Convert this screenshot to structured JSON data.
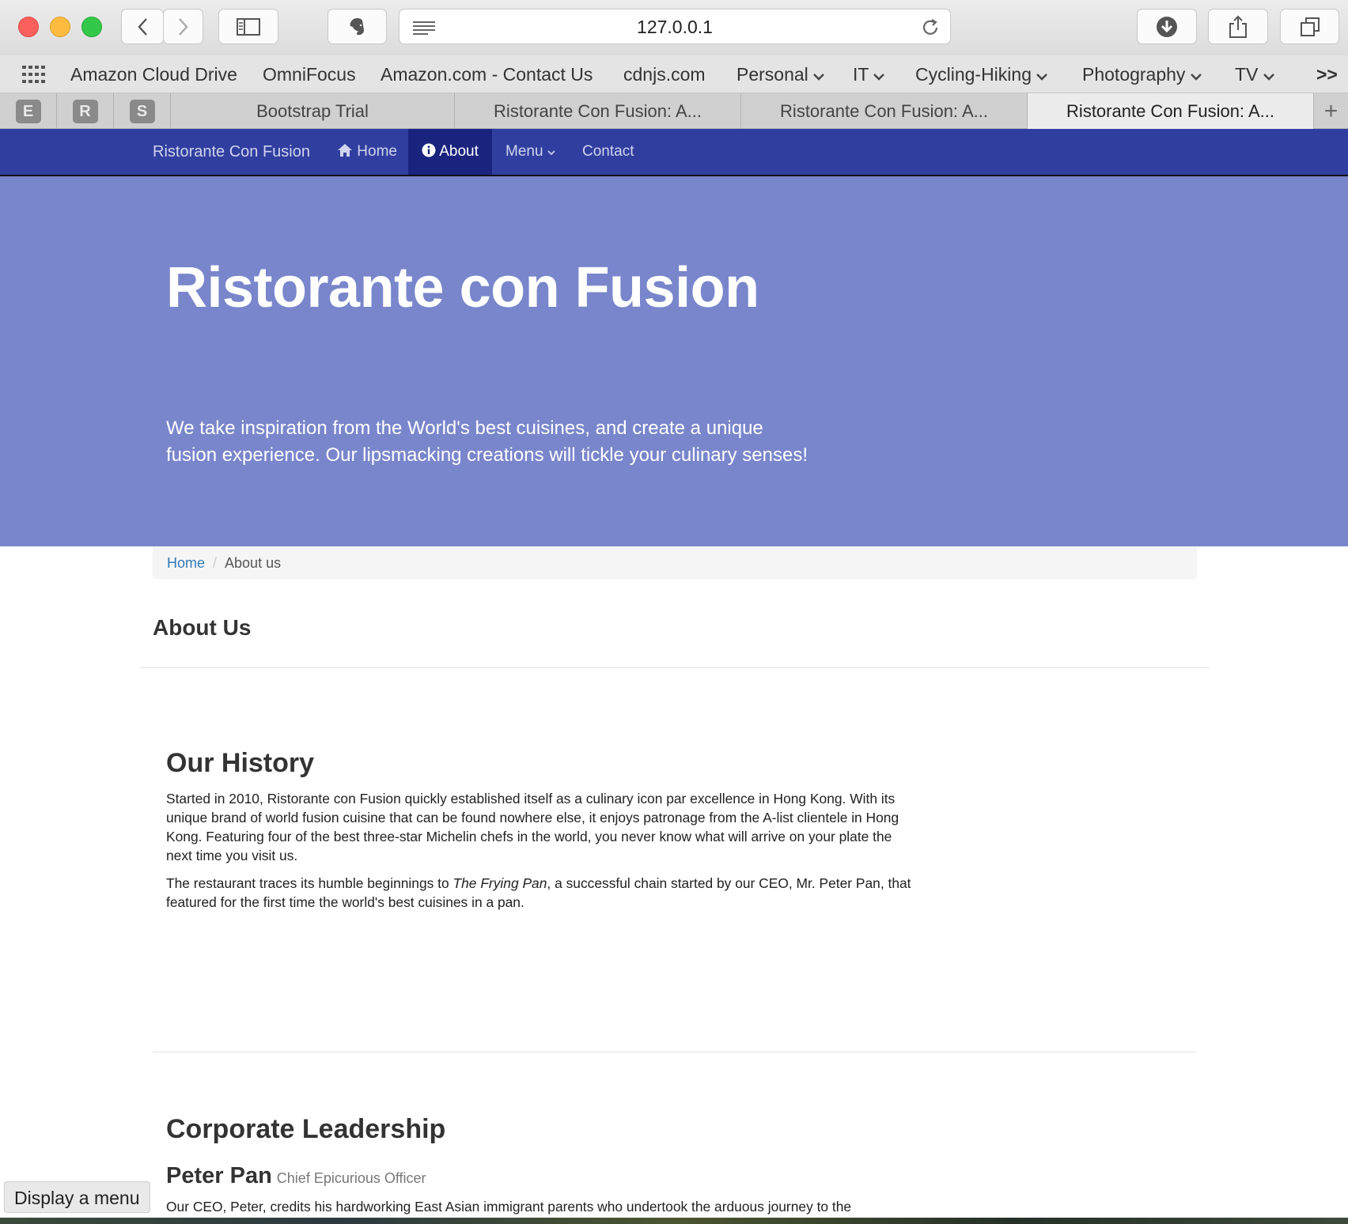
{
  "browser": {
    "url": "127.0.0.1",
    "bookmarks": [
      "Amazon Cloud Drive",
      "OmniFocus",
      "Amazon.com - Contact Us",
      "cdnjs.com",
      "Personal",
      "IT",
      "Cycling-Hiking",
      "Photography",
      "TV"
    ],
    "overflow": ">>",
    "pinned_tabs": [
      "E",
      "R",
      "S"
    ],
    "tabs": [
      "Bootstrap Trial",
      "Ristorante Con Fusion: A...",
      "Ristorante Con Fusion: A...",
      "Ristorante Con Fusion: A..."
    ],
    "new_tab": "+",
    "status_tooltip": "Display a menu"
  },
  "navbar": {
    "brand": "Ristorante Con Fusion",
    "items": [
      {
        "label": "Home",
        "icon": "home-icon"
      },
      {
        "label": "About",
        "icon": "info-circle-icon",
        "active": true
      },
      {
        "label": "Menu",
        "icon": "caret-down-icon"
      },
      {
        "label": "Contact"
      }
    ],
    "colors": {
      "bar": "#303f9f",
      "active": "#1a237e"
    }
  },
  "jumbotron": {
    "title": "Ristorante con Fusion",
    "text": "We take inspiration from the World's best cuisines, and create a unique fusion experience. Our lipsmacking creations will tickle your culinary senses!",
    "color": "#7986cb"
  },
  "breadcrumb": {
    "home": "Home",
    "separator": "/",
    "current": "About us"
  },
  "page": {
    "heading": "About Us",
    "history": {
      "title": "Our History",
      "p1": "Started in 2010, Ristorante con Fusion quickly established itself as a culinary icon par excellence in Hong Kong. With its unique brand of world fusion cuisine that can be found nowhere else, it enjoys patronage from the A-list clientele in Hong Kong. Featuring four of the best three-star Michelin chefs in the world, you never know what will arrive on your plate the next time you visit us.",
      "p2_before": "The restaurant traces its humble beginnings to ",
      "p2_italic": "The Frying Pan",
      "p2_after": ", a successful chain started by our CEO, Mr. Peter Pan, that featured for the first time the world's best cuisines in a pan."
    },
    "leadership": {
      "title": "Corporate Leadership",
      "name": "Peter Pan",
      "role": "Chief Epicurious Officer",
      "bio": "Our CEO, Peter, credits his hardworking East Asian immigrant parents who undertook the arduous journey to the"
    }
  }
}
